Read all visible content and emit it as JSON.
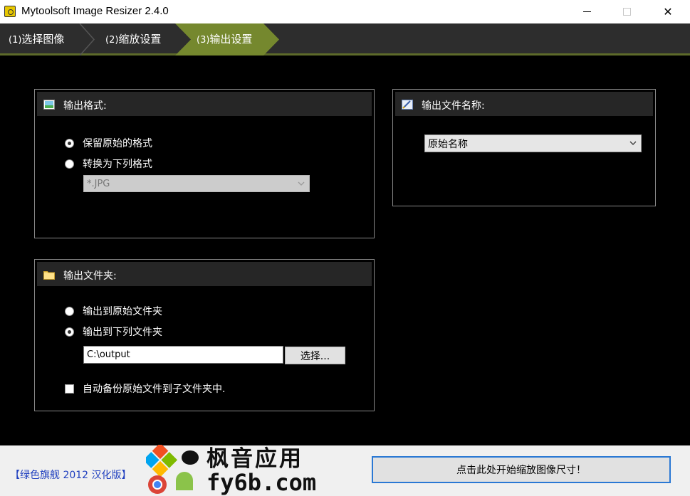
{
  "window": {
    "title": "Mytoolsoft Image Resizer 2.4.0",
    "minimize_glyph": "",
    "close_glyph": "✕"
  },
  "steps": [
    {
      "num": "(1)",
      "label": "选择图像"
    },
    {
      "num": "(2)",
      "label": "缩放设置"
    },
    {
      "num": "(3)",
      "label": "输出设置"
    }
  ],
  "output_format": {
    "title": "输出格式:",
    "keep_original_label": "保留原始的格式",
    "convert_label": "转换为下列格式",
    "format_value": "*.JPG",
    "selected": "keep_original"
  },
  "output_folder": {
    "title": "输出文件夹:",
    "to_original_label": "输出到原始文件夹",
    "to_folder_label": "输出到下列文件夹",
    "path_value": "C:\\output",
    "browse_label": "选择...",
    "backup_label": "自动备份原始文件到子文件夹中.",
    "selected": "to_folder"
  },
  "output_name": {
    "title": "输出文件名称:",
    "value": "原始名称"
  },
  "bottom": {
    "edition": "【绿色旗舰 2012 汉化版】",
    "start_label": "点击此处开始缩放图像尺寸！"
  },
  "watermark": {
    "line1": "枫音应用",
    "line2": "fy6b.com"
  },
  "colors": {
    "active_step": "#75882e",
    "accent": "#2a78d4",
    "edition_text": "#1f3fbf"
  }
}
